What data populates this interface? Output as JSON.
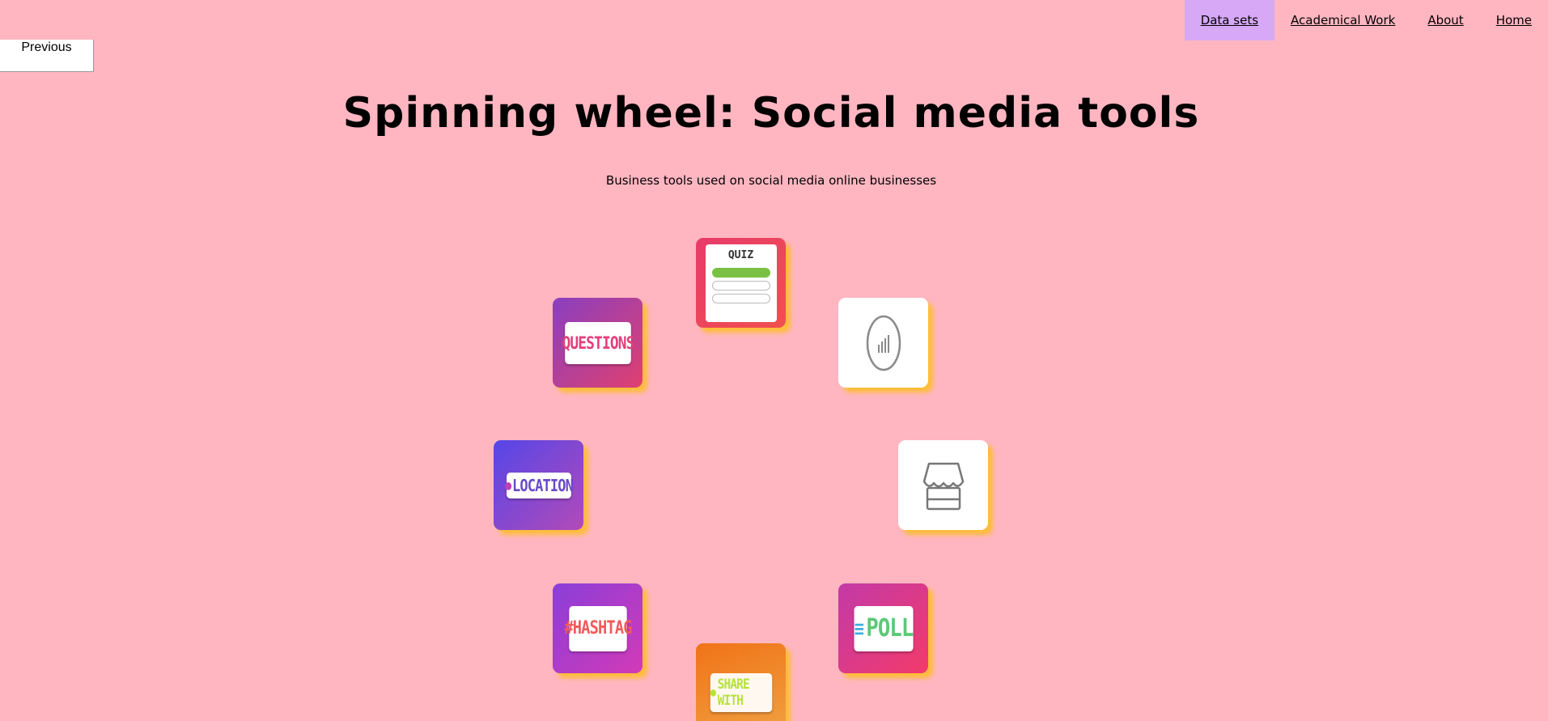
{
  "nav": {
    "items": [
      {
        "label": "Data sets",
        "active": true
      },
      {
        "label": "Academical Work",
        "active": false
      },
      {
        "label": "About",
        "active": false
      },
      {
        "label": "Home",
        "active": false
      }
    ],
    "active_color": "#d6a8f6"
  },
  "previous_button": {
    "label": "Previous"
  },
  "header": {
    "title": "Spinning wheel: Social media tools",
    "subtitle": "Business tools used on social media online businesses"
  },
  "wheel": {
    "tools": [
      {
        "name": "quiz",
        "label": "QUIZ",
        "icon": "quiz-sticker"
      },
      {
        "name": "countdown",
        "label": "",
        "icon": "countdown-icon"
      },
      {
        "name": "shop",
        "label": "",
        "icon": "shop-icon"
      },
      {
        "name": "poll",
        "label": "POLL",
        "icon": "poll-sticker"
      },
      {
        "name": "share-with",
        "label": "SHARE WITH",
        "icon": "share-with-sticker"
      },
      {
        "name": "hashtag",
        "label": "#HASHTAG",
        "icon": "hashtag-sticker"
      },
      {
        "name": "location",
        "label": "LOCATION",
        "icon": "location-sticker"
      },
      {
        "name": "questions",
        "label": "QUESTIONS",
        "icon": "questions-sticker"
      }
    ]
  },
  "colors": {
    "background": "#ffb6c1",
    "tile_shadow": "#ffbe28"
  }
}
